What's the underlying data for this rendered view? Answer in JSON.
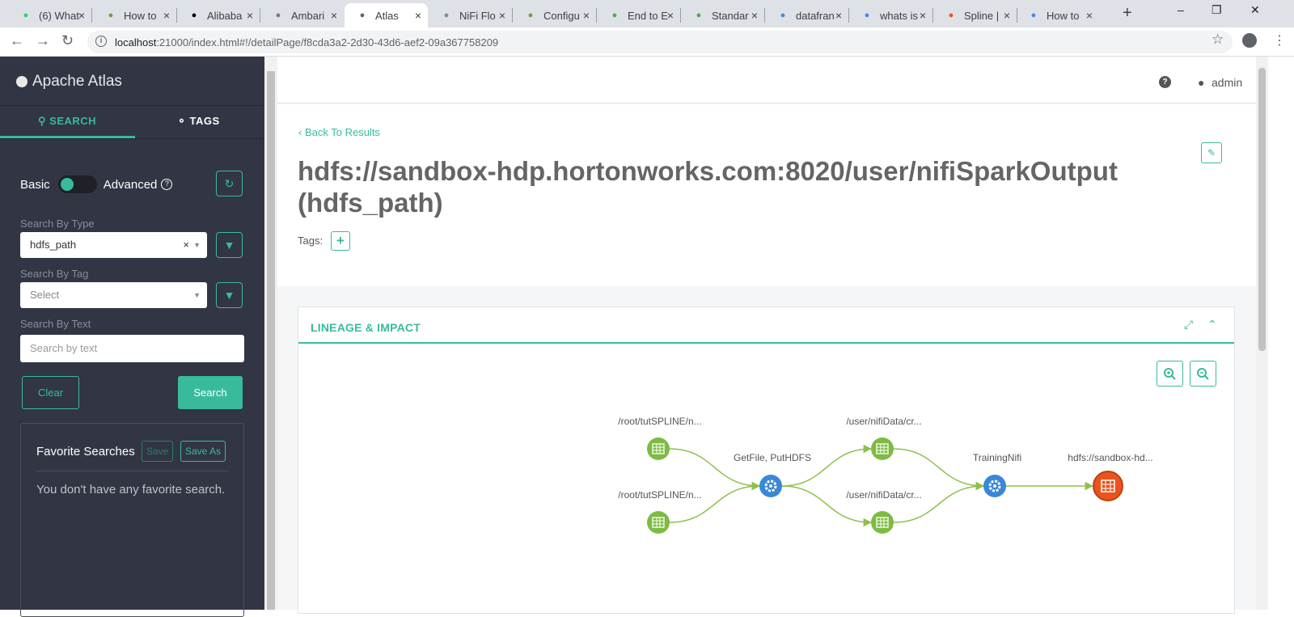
{
  "browser": {
    "tabs": [
      {
        "label": "(6) What",
        "fav": "whatsapp-icon",
        "color": "#25d366"
      },
      {
        "label": "How to",
        "fav": "hadoop-icon",
        "color": "#66a33b"
      },
      {
        "label": "Alibaba",
        "fav": "medium-icon",
        "color": "#000000"
      },
      {
        "label": "Ambari",
        "fav": "ambari-icon",
        "color": "#777777"
      },
      {
        "label": "Atlas",
        "fav": "page-icon",
        "color": "#5f6368"
      },
      {
        "label": "NiFi Flo",
        "fav": "nifi-icon",
        "color": "#728e9b"
      },
      {
        "label": "Configu",
        "fav": "hadoop-icon",
        "color": "#66a33b"
      },
      {
        "label": "End to E",
        "fav": "mongo-icon",
        "color": "#4fa94d"
      },
      {
        "label": "Standar",
        "fav": "mongo-icon",
        "color": "#4fa94d"
      },
      {
        "label": "datafran",
        "fav": "google-icon",
        "color": "#4285f4"
      },
      {
        "label": "whats is",
        "fav": "google-icon",
        "color": "#4285f4"
      },
      {
        "label": "Spline |",
        "fav": "spline-icon",
        "color": "#e8541e"
      },
      {
        "label": "How to",
        "fav": "moon-icon",
        "color": "#3a8ee6"
      }
    ],
    "url_host": "localhost",
    "url_rest": ":21000/index.html#!/detailPage/f8cda3a2-2d30-43d6-aef2-09a367758209"
  },
  "sidebar": {
    "brand": "Apache Atlas",
    "tab_search": "SEARCH",
    "tab_tags": "TAGS",
    "basic_label": "Basic",
    "advanced_label": "Advanced",
    "type_label": "Search By Type",
    "type_value": "hdfs_path",
    "tag_label": "Search By Tag",
    "tag_placeholder": "Select",
    "text_label": "Search By Text",
    "text_placeholder": "Search by text",
    "clear_label": "Clear",
    "search_label": "Search",
    "fav_title": "Favorite Searches",
    "fav_save": "Save",
    "fav_save_as": "Save As",
    "fav_empty": "You don't have any favorite search."
  },
  "header": {
    "user": "admin"
  },
  "detail": {
    "back": "Back To Results",
    "title": "hdfs://sandbox-hdp.hortonworks.com:8020/user/nifiSparkOutput (hdfs_path)",
    "tags_label": "Tags:"
  },
  "lineage": {
    "title": "LINEAGE & IMPACT",
    "nodes": [
      {
        "label": "/root/tutSPLINE/n...",
        "kind": "dataset"
      },
      {
        "label": "/root/tutSPLINE/n...",
        "kind": "dataset"
      },
      {
        "label": "GetFile, PutHDFS",
        "kind": "process"
      },
      {
        "label": "/user/nifiData/cr...",
        "kind": "dataset"
      },
      {
        "label": "/user/nifiData/cr...",
        "kind": "dataset"
      },
      {
        "label": "TrainingNifi",
        "kind": "process"
      },
      {
        "label": "hdfs://sandbox-hd...",
        "kind": "current"
      }
    ],
    "colors": {
      "dataset": "#7dbb42",
      "process": "#3a87d6",
      "current": "#e8541e",
      "edge": "#8fc04d"
    }
  }
}
